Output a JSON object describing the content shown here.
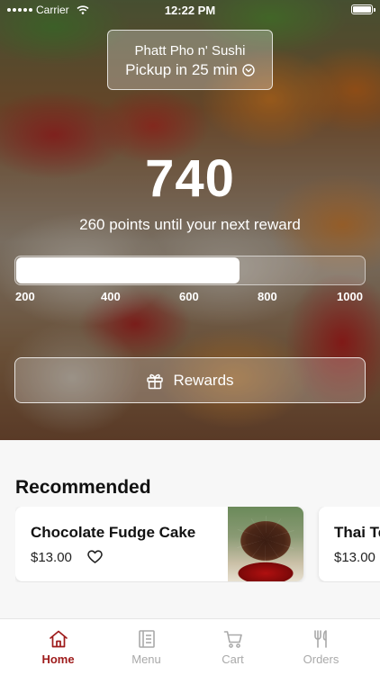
{
  "status_bar": {
    "carrier": "Carrier",
    "time": "12:22 PM"
  },
  "location": {
    "store_name": "Phatt Pho n' Sushi",
    "pickup_text": "Pickup in 25 min"
  },
  "rewards": {
    "points": "740",
    "subtitle": "260 points until your next reward",
    "progress_fraction": 0.64,
    "scale_labels": [
      "200",
      "400",
      "600",
      "800",
      "1000"
    ],
    "button_label": "Rewards"
  },
  "recommended": {
    "title": "Recommended",
    "items": [
      {
        "name": "Chocolate Fudge Cake",
        "price": "$13.00"
      },
      {
        "name": "Thai Te",
        "price": "$13.00"
      }
    ]
  },
  "tabs": [
    {
      "label": "Home",
      "icon": "home-icon",
      "active": true
    },
    {
      "label": "Menu",
      "icon": "menu-icon",
      "active": false
    },
    {
      "label": "Cart",
      "icon": "cart-icon",
      "active": false
    },
    {
      "label": "Orders",
      "icon": "orders-icon",
      "active": false
    }
  ],
  "colors": {
    "accent": "#9e1b1b",
    "inactive_tab": "#a9a9a9"
  }
}
